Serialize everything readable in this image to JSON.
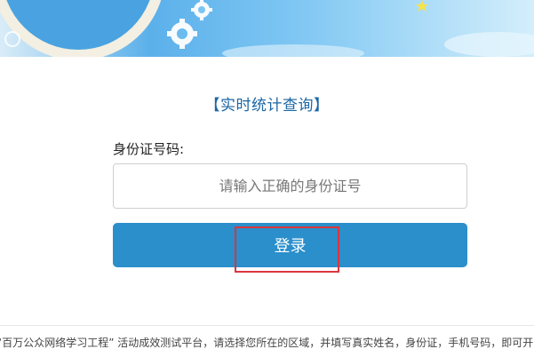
{
  "banner": {
    "colors": {
      "sky": "#5bb0ea",
      "gear": "#ffffff",
      "star": "#f4e34a"
    },
    "icons": [
      "gear-icon",
      "gear-icon",
      "star-icon"
    ]
  },
  "page_title": "【实时统计查询】",
  "form": {
    "id_label": "身份证号码:",
    "id_placeholder": "请输入正确的身份证号",
    "id_value": "",
    "login_label": "登录"
  },
  "footer": {
    "text": "“百万公众网络学习工程” 活动成效测试平台，请选择您所在的区域，并填写真实姓名，身份证，手机号码，即可开"
  },
  "colors": {
    "title": "#1b66a6",
    "button": "#2a8fcb",
    "highlight": "#d9363e"
  }
}
